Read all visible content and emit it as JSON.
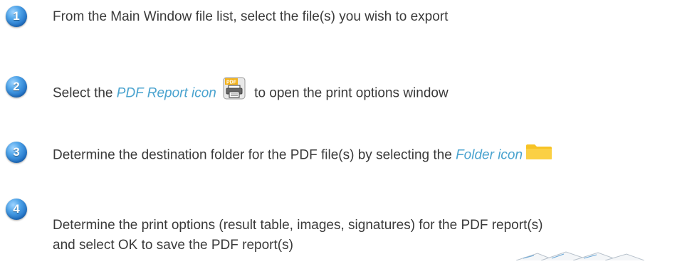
{
  "steps": [
    {
      "number": "1",
      "text": "From the Main Window file list, select the file(s) you wish to export"
    },
    {
      "number": "2",
      "pre": "Select the ",
      "highlight": "PDF Report icon",
      "post": " to open the print options window",
      "icon_label": "PDF"
    },
    {
      "number": "3",
      "pre": "Determine the destination folder for the PDF file(s) by selecting the ",
      "highlight": "Folder icon"
    },
    {
      "number": "4",
      "line1": "Determine the print options (result table, images, signatures) for the PDF report(s)",
      "line2": "and select OK to save the PDF report(s)"
    }
  ],
  "colors": {
    "highlight": "#4aa3cf",
    "badge": "#2d7fd1",
    "folder": "#f7c325"
  }
}
